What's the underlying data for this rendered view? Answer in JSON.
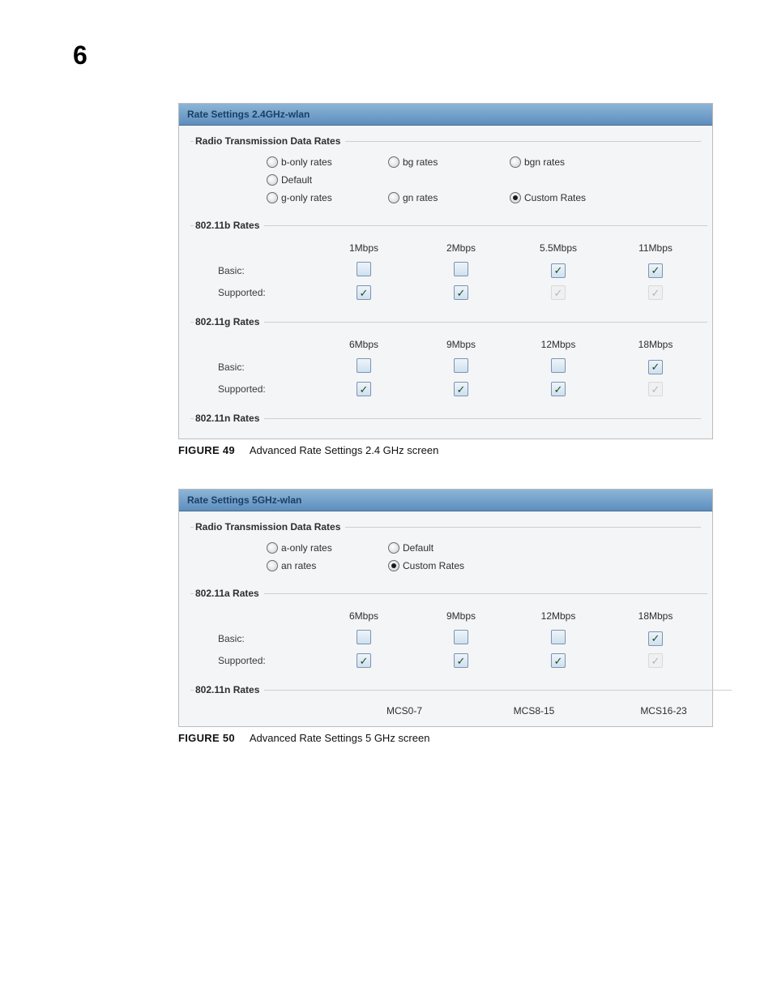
{
  "page_number": "6",
  "figure49": {
    "panel_title": "Rate Settings 2.4GHz-wlan",
    "section_rates": {
      "legend": "Radio Transmission Data Rates",
      "options": [
        {
          "label": "b-only rates",
          "selected": false
        },
        {
          "label": "bg rates",
          "selected": false
        },
        {
          "label": "bgn rates",
          "selected": false
        },
        {
          "label": "Default",
          "selected": false
        },
        {
          "label": "g-only rates",
          "selected": false
        },
        {
          "label": "gn rates",
          "selected": false
        },
        {
          "label": "Custom Rates",
          "selected": true
        }
      ]
    },
    "section_b": {
      "legend": "802.11b Rates",
      "headers": [
        "1Mbps",
        "2Mbps",
        "5.5Mbps",
        "11Mbps"
      ],
      "row_basic_label": "Basic:",
      "row_basic": [
        {
          "checked": false,
          "disabled": false
        },
        {
          "checked": false,
          "disabled": false
        },
        {
          "checked": true,
          "disabled": false
        },
        {
          "checked": true,
          "disabled": false
        }
      ],
      "row_supported_label": "Supported:",
      "row_supported": [
        {
          "checked": true,
          "disabled": false
        },
        {
          "checked": true,
          "disabled": false
        },
        {
          "checked": true,
          "disabled": true
        },
        {
          "checked": true,
          "disabled": true
        }
      ]
    },
    "section_g": {
      "legend": "802.11g Rates",
      "headers": [
        "6Mbps",
        "9Mbps",
        "12Mbps",
        "18Mbps"
      ],
      "row_basic_label": "Basic:",
      "row_basic": [
        {
          "checked": false,
          "disabled": false
        },
        {
          "checked": false,
          "disabled": false
        },
        {
          "checked": false,
          "disabled": false
        },
        {
          "checked": true,
          "disabled": false
        }
      ],
      "row_supported_label": "Supported:",
      "row_supported": [
        {
          "checked": true,
          "disabled": false
        },
        {
          "checked": true,
          "disabled": false
        },
        {
          "checked": true,
          "disabled": false
        },
        {
          "checked": true,
          "disabled": true
        }
      ]
    },
    "section_n": {
      "legend": "802.11n Rates"
    },
    "caption_label": "FIGURE 49",
    "caption_text": "Advanced Rate Settings 2.4 GHz screen"
  },
  "figure50": {
    "panel_title": "Rate Settings 5GHz-wlan",
    "section_rates": {
      "legend": "Radio Transmission Data Rates",
      "options": [
        {
          "label": "a-only rates",
          "selected": false
        },
        {
          "label": "Default",
          "selected": false
        },
        {
          "label": "an rates",
          "selected": false
        },
        {
          "label": "Custom Rates",
          "selected": true
        }
      ]
    },
    "section_a": {
      "legend": "802.11a Rates",
      "headers": [
        "6Mbps",
        "9Mbps",
        "12Mbps",
        "18Mbps"
      ],
      "row_basic_label": "Basic:",
      "row_basic": [
        {
          "checked": false,
          "disabled": false
        },
        {
          "checked": false,
          "disabled": false
        },
        {
          "checked": false,
          "disabled": false
        },
        {
          "checked": true,
          "disabled": false
        }
      ],
      "row_supported_label": "Supported:",
      "row_supported": [
        {
          "checked": true,
          "disabled": false
        },
        {
          "checked": true,
          "disabled": false
        },
        {
          "checked": true,
          "disabled": false
        },
        {
          "checked": true,
          "disabled": true
        }
      ]
    },
    "section_n": {
      "legend": "802.11n Rates",
      "headers": [
        "MCS0-7",
        "MCS8-15",
        "MCS16-23"
      ]
    },
    "caption_label": "FIGURE 50",
    "caption_text": "Advanced Rate Settings 5 GHz screen"
  }
}
